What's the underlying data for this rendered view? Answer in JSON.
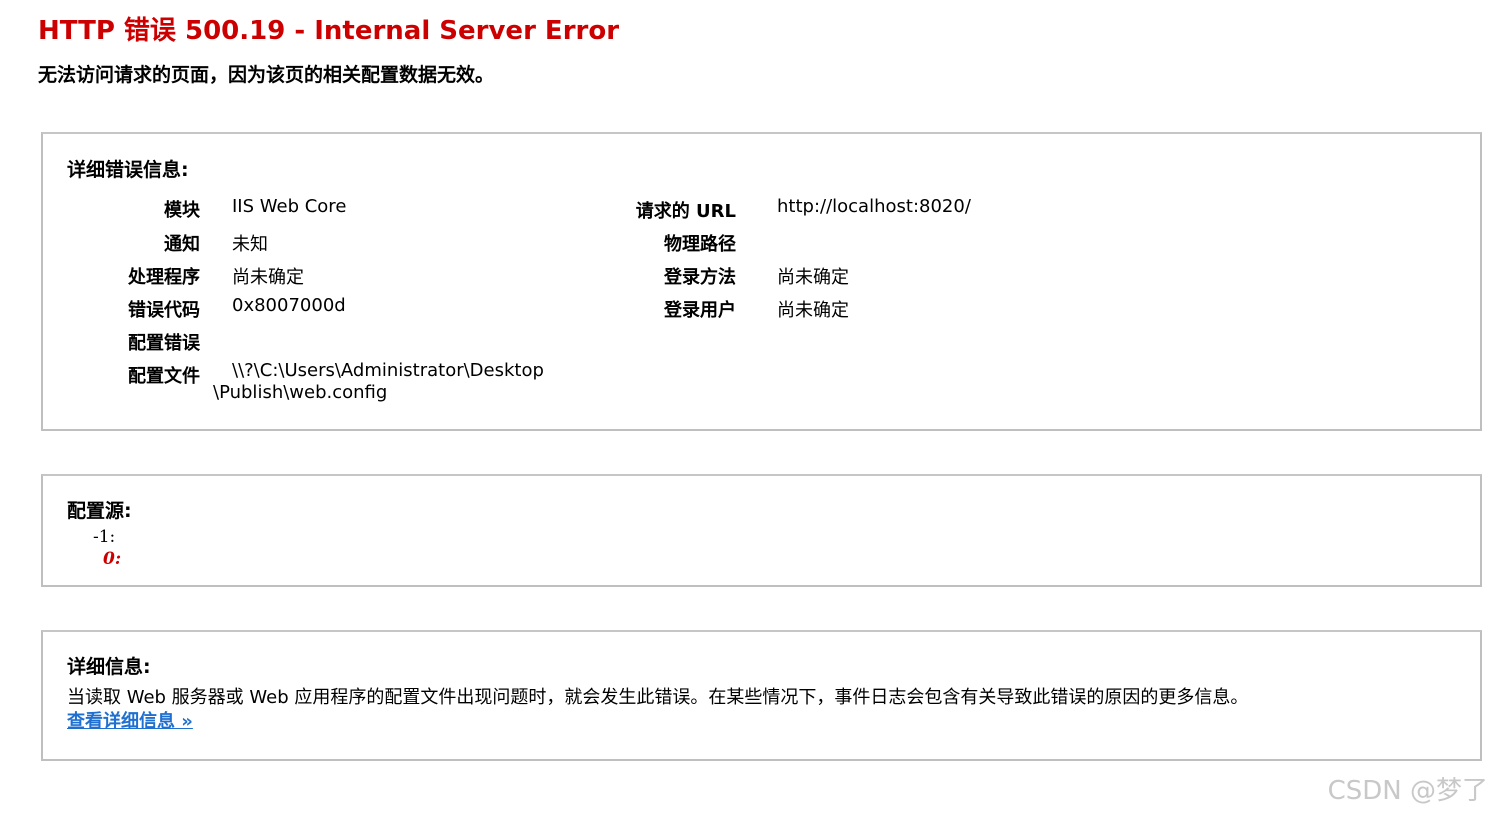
{
  "header": {
    "title": "HTTP 错误 500.19 - Internal Server Error",
    "subtitle": "无法访问请求的页面，因为该页的相关配置数据无效。"
  },
  "details": {
    "heading": "详细错误信息:",
    "left": [
      {
        "label": "模块",
        "value": "IIS Web Core"
      },
      {
        "label": "通知",
        "value": "未知"
      },
      {
        "label": "处理程序",
        "value": "尚未确定"
      },
      {
        "label": "错误代码",
        "value": "0x8007000d"
      },
      {
        "label": "配置错误",
        "value": ""
      },
      {
        "label": "配置文件",
        "value": "\\\\?\\C:\\Users\\Administrator\\Desktop\\Publish\\web.config"
      }
    ],
    "right": [
      {
        "label": "请求的 URL",
        "value": "http://localhost:8020/"
      },
      {
        "label": "物理路径",
        "value": ""
      },
      {
        "label": "登录方法",
        "value": "尚未确定"
      },
      {
        "label": "登录用户",
        "value": "尚未确定"
      }
    ]
  },
  "source": {
    "heading": "配置源:",
    "lines": [
      "-1:",
      "0:"
    ]
  },
  "more_info": {
    "heading": "详细信息:",
    "description": "当读取 Web 服务器或 Web 应用程序的配置文件出现问题时，就会发生此错误。在某些情况下，事件日志会包含有关导致此错误的原因的更多信息。",
    "link_label": "查看详细信息 »"
  },
  "watermark": "CSDN @梦了",
  "colors": {
    "title": "#cc0000",
    "link": "#1f6fd1",
    "border": "#bfbfbf"
  }
}
